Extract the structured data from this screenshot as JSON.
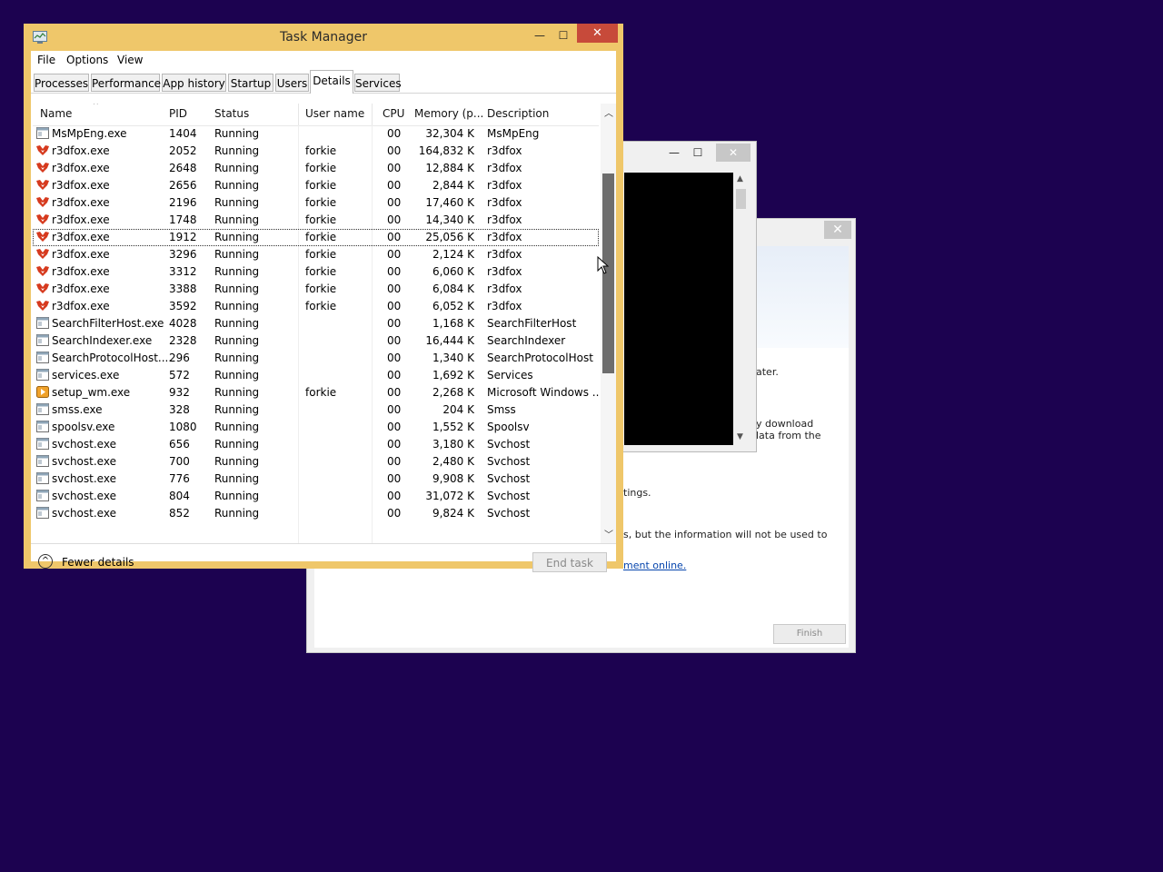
{
  "background_installer": {
    "close_label": "✕",
    "snippets": [
      "ater.",
      "y download",
      "lata from the",
      "tings.",
      "s, but the information will not be used to",
      "ment online."
    ],
    "finish_label": "Finish"
  },
  "console_window": {
    "minimize_label": "—",
    "maximize_label": "☐",
    "close_label": "✕"
  },
  "task_manager": {
    "title": "Task Manager",
    "controls": {
      "minimize": "—",
      "maximize": "☐",
      "close": "✕"
    },
    "menu": [
      "File",
      "Options",
      "View"
    ],
    "tabs": [
      {
        "label": "Processes",
        "active": false
      },
      {
        "label": "Performance",
        "active": false
      },
      {
        "label": "App history",
        "active": false
      },
      {
        "label": "Startup",
        "active": false
      },
      {
        "label": "Users",
        "active": false
      },
      {
        "label": "Details",
        "active": true
      },
      {
        "label": "Services",
        "active": false
      }
    ],
    "columns": [
      "Name",
      "PID",
      "Status",
      "User name",
      "CPU",
      "Memory (p...",
      "Description"
    ],
    "sort_indicator": "^",
    "rows": [
      {
        "icon": "generic",
        "name": "MsMpEng.exe",
        "pid": "1404",
        "status": "Running",
        "user": "",
        "cpu": "00",
        "memory": "32,304 K",
        "description": "MsMpEng"
      },
      {
        "icon": "r3dfox",
        "name": "r3dfox.exe",
        "pid": "2052",
        "status": "Running",
        "user": "forkie",
        "cpu": "00",
        "memory": "164,832 K",
        "description": "r3dfox"
      },
      {
        "icon": "r3dfox",
        "name": "r3dfox.exe",
        "pid": "2648",
        "status": "Running",
        "user": "forkie",
        "cpu": "00",
        "memory": "12,884 K",
        "description": "r3dfox"
      },
      {
        "icon": "r3dfox",
        "name": "r3dfox.exe",
        "pid": "2656",
        "status": "Running",
        "user": "forkie",
        "cpu": "00",
        "memory": "2,844 K",
        "description": "r3dfox"
      },
      {
        "icon": "r3dfox",
        "name": "r3dfox.exe",
        "pid": "2196",
        "status": "Running",
        "user": "forkie",
        "cpu": "00",
        "memory": "17,460 K",
        "description": "r3dfox"
      },
      {
        "icon": "r3dfox",
        "name": "r3dfox.exe",
        "pid": "1748",
        "status": "Running",
        "user": "forkie",
        "cpu": "00",
        "memory": "14,340 K",
        "description": "r3dfox"
      },
      {
        "icon": "r3dfox",
        "name": "r3dfox.exe",
        "pid": "1912",
        "status": "Running",
        "user": "forkie",
        "cpu": "00",
        "memory": "25,056 K",
        "description": "r3dfox",
        "selected": true
      },
      {
        "icon": "r3dfox",
        "name": "r3dfox.exe",
        "pid": "3296",
        "status": "Running",
        "user": "forkie",
        "cpu": "00",
        "memory": "2,124 K",
        "description": "r3dfox"
      },
      {
        "icon": "r3dfox",
        "name": "r3dfox.exe",
        "pid": "3312",
        "status": "Running",
        "user": "forkie",
        "cpu": "00",
        "memory": "6,060 K",
        "description": "r3dfox"
      },
      {
        "icon": "r3dfox",
        "name": "r3dfox.exe",
        "pid": "3388",
        "status": "Running",
        "user": "forkie",
        "cpu": "00",
        "memory": "6,084 K",
        "description": "r3dfox"
      },
      {
        "icon": "r3dfox",
        "name": "r3dfox.exe",
        "pid": "3592",
        "status": "Running",
        "user": "forkie",
        "cpu": "00",
        "memory": "6,052 K",
        "description": "r3dfox"
      },
      {
        "icon": "generic",
        "name": "SearchFilterHost.exe",
        "pid": "4028",
        "status": "Running",
        "user": "",
        "cpu": "00",
        "memory": "1,168 K",
        "description": "SearchFilterHost"
      },
      {
        "icon": "generic",
        "name": "SearchIndexer.exe",
        "pid": "2328",
        "status": "Running",
        "user": "",
        "cpu": "00",
        "memory": "16,444 K",
        "description": "SearchIndexer"
      },
      {
        "icon": "generic",
        "name": "SearchProtocolHost....",
        "pid": "296",
        "status": "Running",
        "user": "",
        "cpu": "00",
        "memory": "1,340 K",
        "description": "SearchProtocolHost"
      },
      {
        "icon": "generic",
        "name": "services.exe",
        "pid": "572",
        "status": "Running",
        "user": "",
        "cpu": "00",
        "memory": "1,692 K",
        "description": "Services"
      },
      {
        "icon": "setup",
        "name": "setup_wm.exe",
        "pid": "932",
        "status": "Running",
        "user": "forkie",
        "cpu": "00",
        "memory": "2,268 K",
        "description": "Microsoft Windows ..."
      },
      {
        "icon": "generic",
        "name": "smss.exe",
        "pid": "328",
        "status": "Running",
        "user": "",
        "cpu": "00",
        "memory": "204 K",
        "description": "Smss"
      },
      {
        "icon": "generic",
        "name": "spoolsv.exe",
        "pid": "1080",
        "status": "Running",
        "user": "",
        "cpu": "00",
        "memory": "1,552 K",
        "description": "Spoolsv"
      },
      {
        "icon": "generic",
        "name": "svchost.exe",
        "pid": "656",
        "status": "Running",
        "user": "",
        "cpu": "00",
        "memory": "3,180 K",
        "description": "Svchost"
      },
      {
        "icon": "generic",
        "name": "svchost.exe",
        "pid": "700",
        "status": "Running",
        "user": "",
        "cpu": "00",
        "memory": "2,480 K",
        "description": "Svchost"
      },
      {
        "icon": "generic",
        "name": "svchost.exe",
        "pid": "776",
        "status": "Running",
        "user": "",
        "cpu": "00",
        "memory": "9,908 K",
        "description": "Svchost"
      },
      {
        "icon": "generic",
        "name": "svchost.exe",
        "pid": "804",
        "status": "Running",
        "user": "",
        "cpu": "00",
        "memory": "31,072 K",
        "description": "Svchost"
      },
      {
        "icon": "generic",
        "name": "svchost.exe",
        "pid": "852",
        "status": "Running",
        "user": "",
        "cpu": "00",
        "memory": "9,824 K",
        "description": "Svchost"
      }
    ],
    "footer": {
      "fewer_details_label": "Fewer details",
      "fewer_icon": "^",
      "end_task_label": "End task"
    }
  },
  "colors": {
    "desktop": "#1c0250",
    "tm_frame": "#efc76a",
    "close_red": "#c74a3a",
    "r3dfox_red": "#d63a1e"
  }
}
